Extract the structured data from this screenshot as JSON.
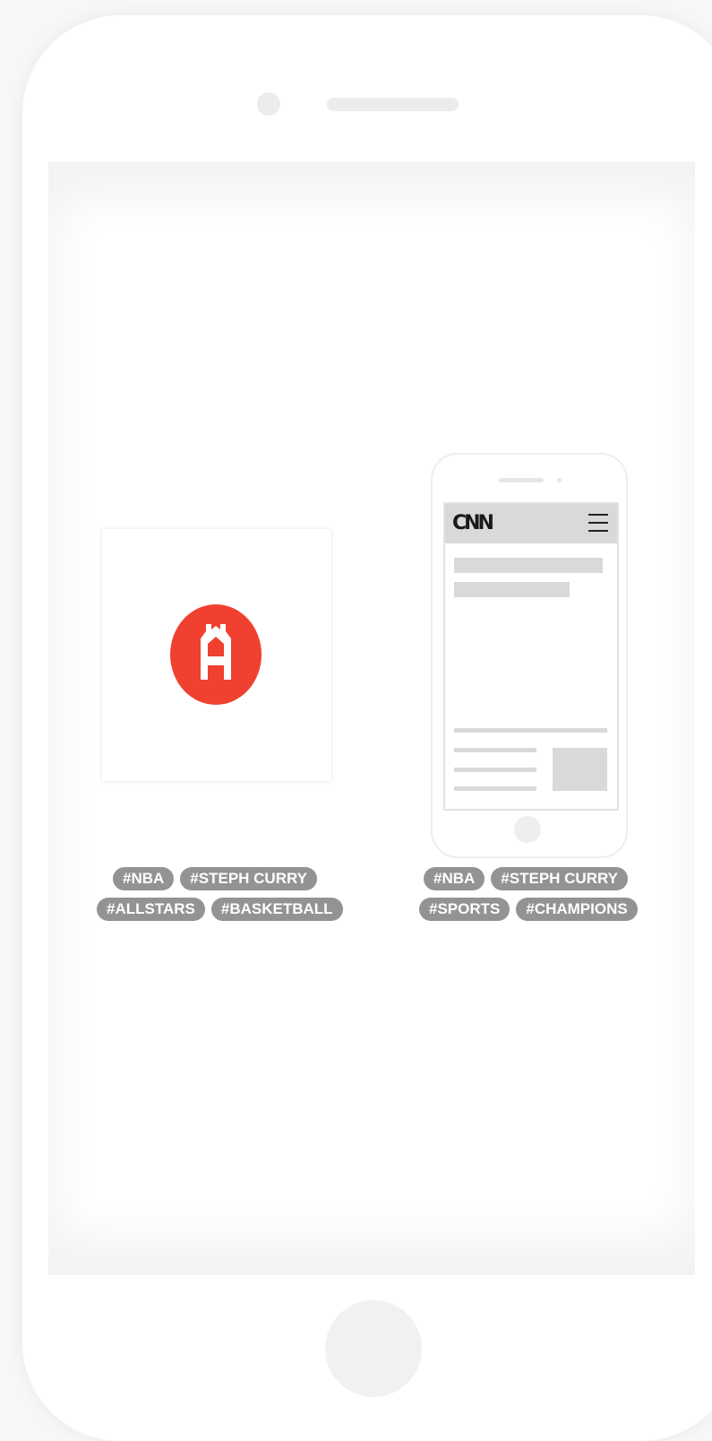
{
  "device": {
    "camera": "front-camera",
    "speaker": "earpiece-speaker",
    "home_button": "home-button"
  },
  "left_panel": {
    "app_icon": "castle-logo-icon",
    "app_icon_color": "#f04030",
    "tags_row1": [
      "#NBA",
      "#STEPH CURRY"
    ],
    "tags_row2": [
      "#ALLSTARS",
      "#BASKETBALL"
    ]
  },
  "right_panel": {
    "site_logo": "CNN",
    "menu_icon": "hamburger-menu-icon",
    "tags_row1": [
      "#NBA",
      "#STEPH CURRY"
    ],
    "tags_row2": [
      "#SPORTS",
      "#CHAMPIONS"
    ]
  },
  "colors": {
    "tag_background": "#939393",
    "tag_text": "#ffffff",
    "placeholder": "#d9d9d9"
  }
}
